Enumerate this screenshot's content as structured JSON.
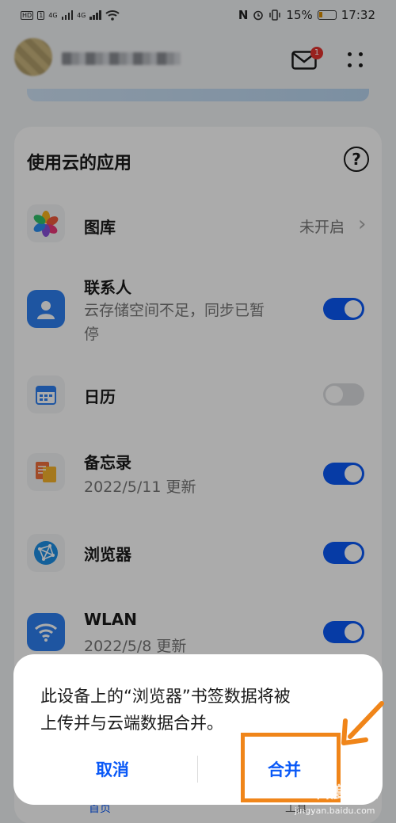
{
  "status_bar": {
    "left_badges": [
      "HD",
      "1",
      "4G",
      "4G"
    ],
    "nfc": "N",
    "battery": "15%",
    "time": "17:32"
  },
  "header": {
    "mail_badge": "1",
    "icons": [
      "avatar",
      "mail-icon",
      "more-icon"
    ]
  },
  "section": {
    "title": "使用云的应用",
    "help_symbol": "?"
  },
  "apps": [
    {
      "name": "图库",
      "status": "未开启",
      "chevron": "›",
      "icon": "gallery-icon"
    },
    {
      "name": "联系人",
      "subtitle_line1": "云存储空间不足，同步已暂",
      "subtitle_line2": "停",
      "toggle": true,
      "icon": "contacts-icon"
    },
    {
      "name": "日历",
      "toggle": false,
      "icon": "calendar-icon"
    },
    {
      "name": "备忘录",
      "subtitle": "2022/5/11 更新",
      "toggle": true,
      "icon": "notepad-icon"
    },
    {
      "name": "浏览器",
      "toggle": true,
      "icon": "browser-icon"
    },
    {
      "name": "WLAN",
      "subtitle": "2022/5/8 更新",
      "toggle": true,
      "icon": "wlan-icon"
    }
  ],
  "bottom_nav": {
    "home": "首页",
    "tools": "工具"
  },
  "dialog": {
    "message_line1": "此设备上的“浏览器”书签数据将被",
    "message_line2": "上传并与云端数据合并。",
    "cancel": "取消",
    "confirm": "合并"
  },
  "watermark": {
    "brand": "Bai百度经验",
    "url": "jingyan.baidu.com"
  },
  "colors": {
    "accent": "#0a59f7",
    "highlight": "#f08519",
    "badge": "#e5322d"
  }
}
